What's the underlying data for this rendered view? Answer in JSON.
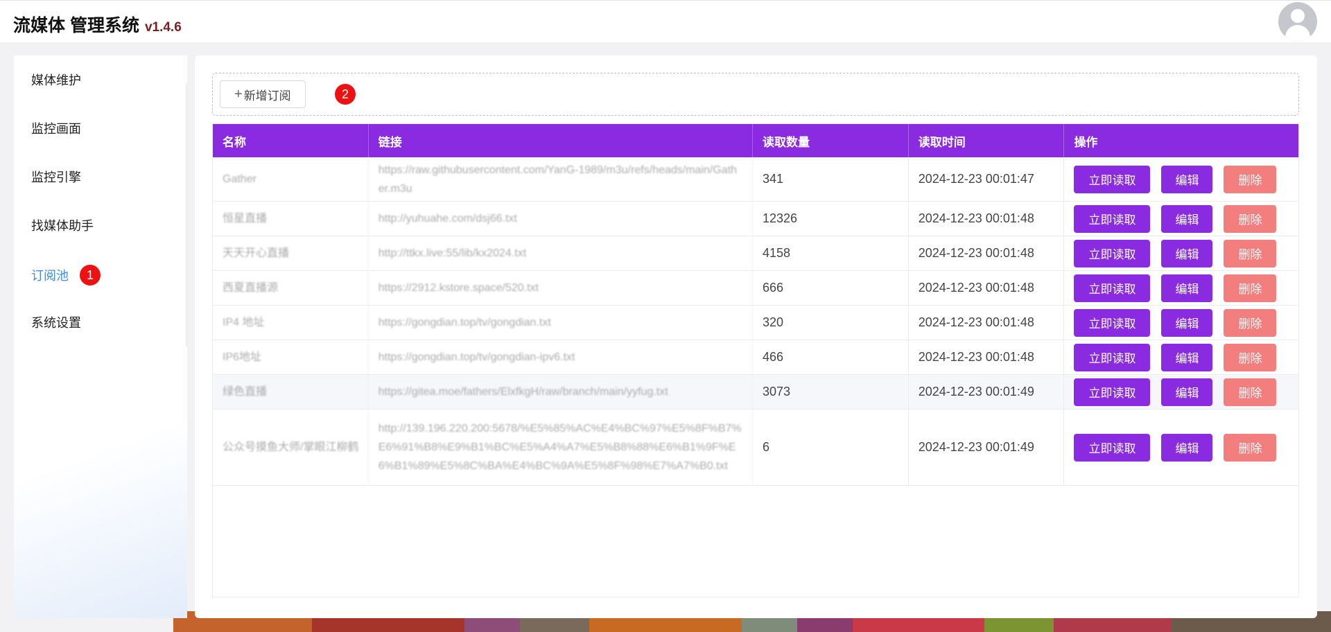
{
  "header": {
    "title": "流媒体 管理系统",
    "version": "v1.4.6",
    "avatar_icon": "user-avatar-icon"
  },
  "sidebar": {
    "items": [
      {
        "label": "媒体维护",
        "active": false
      },
      {
        "label": "监控画面",
        "active": false
      },
      {
        "label": "监控引擎",
        "active": false
      },
      {
        "label": "找媒体助手",
        "active": false
      },
      {
        "label": "订阅池",
        "active": true,
        "badge": "1"
      },
      {
        "label": "系统设置",
        "active": false
      }
    ]
  },
  "toolbar": {
    "add_label": "新增订阅",
    "plus_glyph": "+",
    "badge": "2"
  },
  "table": {
    "headers": [
      "名称",
      "链接",
      "读取数量",
      "读取时间",
      "操作"
    ],
    "rows": [
      {
        "name": "Gather",
        "url": "https://raw.githubusercontent.com/YanG-1989/m3u/refs/heads/main/Gather.m3u",
        "count": "341",
        "time": "2024-12-23 00:01:47"
      },
      {
        "name": "恒星直播",
        "url": "http://yuhuahe.com/dsj66.txt",
        "count": "12326",
        "time": "2024-12-23 00:01:48"
      },
      {
        "name": "天天开心直播",
        "url": "http://ttkx.live:55/lib/kx2024.txt",
        "count": "4158",
        "time": "2024-12-23 00:01:48"
      },
      {
        "name": "西夏直播源",
        "url": "https://2912.kstore.space/520.txt",
        "count": "666",
        "time": "2024-12-23 00:01:48"
      },
      {
        "name": "IP4 地址",
        "url": "https://gongdian.top/tv/gongdian.txt",
        "count": "320",
        "time": "2024-12-23 00:01:48"
      },
      {
        "name": "IP6地址",
        "url": "https://gongdian.top/tv/gongdian-ipv6.txt",
        "count": "466",
        "time": "2024-12-23 00:01:48"
      },
      {
        "name": "绿色直播",
        "url": "https://gitea.moe/fathers/ElxfkgH/raw/branch/main/yyfug.txt",
        "count": "3073",
        "time": "2024-12-23 00:01:49"
      },
      {
        "name": "公众号摸鱼大师/掌眼江柳鹤",
        "url": "http://139.196.220.200:5678/%E5%85%AC%E4%BC%97%E5%8F%B7%E6%91%B8%E9%B1%BC%E5%A4%A7%E5%B8%88%E6%B1%9F%E6%B1%89%E5%8C%BA%E4%BC%9A%E5%8F%98%E7%A7%B0.txt",
        "count": "6",
        "time": "2024-12-23 00:01:49"
      }
    ],
    "actions": {
      "read": "立即读取",
      "edit": "编辑",
      "delete": "删除"
    }
  },
  "colors": {
    "accent": "#8a2be2",
    "danger": "#f27e7e",
    "active_nav": "#3d8ee0",
    "badge": "#ee1111",
    "version": "#7a1f22"
  }
}
